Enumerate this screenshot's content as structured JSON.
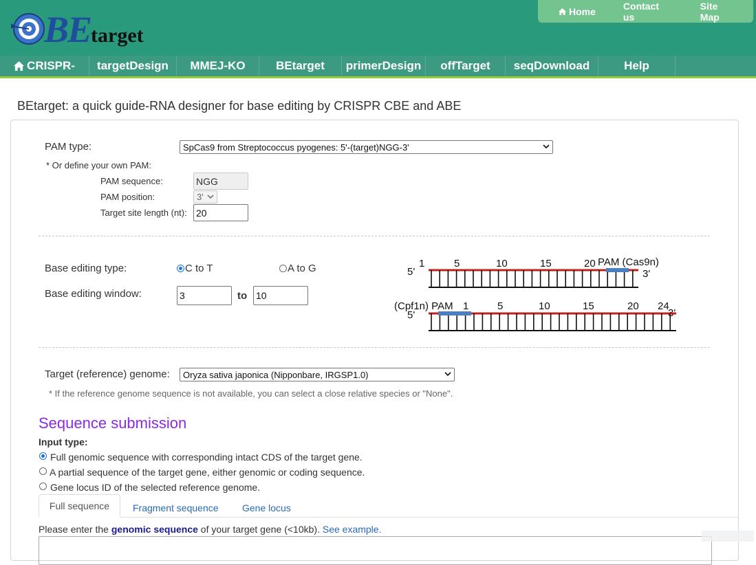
{
  "brand": {
    "logo_be": "BE",
    "logo_target": "target"
  },
  "top_links": [
    "Home",
    "Contact us",
    "Site Map"
  ],
  "nav": [
    "CRISPR-",
    "targetDesign",
    "MMEJ-KO",
    "BEtarget",
    "primerDesign",
    "offTarget",
    "seqDownload",
    "Help"
  ],
  "page_title": "BEtarget: a quick guide-RNA designer for base editing by CRISPR CBE and ABE",
  "pam": {
    "label": "PAM type:",
    "selected": "SpCas9 from Streptococcus pyogenes: 5'-(target)NGG-3'",
    "custom_note": "* Or define your own PAM:",
    "seq_label": "PAM sequence:",
    "seq_value": "NGG",
    "pos_label": "PAM position:",
    "pos_value": "3'",
    "len_label": "Target site length (nt):",
    "len_value": "20"
  },
  "base_edit": {
    "type_label": "Base editing type:",
    "opt_c_to_t": "C to T",
    "opt_a_to_g": "A to G",
    "selected_type": "C to T",
    "window_label": "Base editing window:",
    "window_from": "3",
    "window_to_label": "to",
    "window_to": "10"
  },
  "diagram": {
    "cas9": {
      "five": "5'",
      "three": "3'",
      "ticks": [
        "1",
        "5",
        "10",
        "15",
        "20"
      ],
      "pam_label": "PAM (Cas9n)"
    },
    "cpf1": {
      "five": "5'",
      "three": "3'",
      "pam_label": "(Cpf1n) PAM",
      "ticks": [
        "1",
        "5",
        "10",
        "15",
        "20",
        "24"
      ]
    },
    "colors": {
      "strand": "#c0201e",
      "pam": "#4a7fc1",
      "line": "#111111"
    }
  },
  "genome": {
    "label": "Target (reference) genome:",
    "selected": "Oryza sativa japonica (Nipponbare, IRGSP1.0)",
    "note": "* If the reference genome sequence is not available, you can select a close relative species or \"None\"."
  },
  "submission": {
    "title": "Sequence submission",
    "input_type_label": "Input type:",
    "options": [
      "Full genomic sequence with corresponding intact CDS of the target gene.",
      "A partial sequence of the target gene, either genomic or coding sequence.",
      "Gene locus ID of the selected reference genome."
    ],
    "selected_option": 0,
    "tabs": [
      "Full sequence",
      "Fragment sequence",
      "Gene locus"
    ],
    "prompt_pre": "Please enter the ",
    "prompt_bold": "genomic sequence",
    "prompt_post": " of your target gene (<10kb). ",
    "prompt_link": "See example."
  },
  "colors": {
    "header_bg": "#2a9a7c",
    "nav_bg": "#3c9a82",
    "toplinks_bg": "#74c48f",
    "nav_underline": "#9cc83c",
    "section_title": "#8a2be2"
  }
}
